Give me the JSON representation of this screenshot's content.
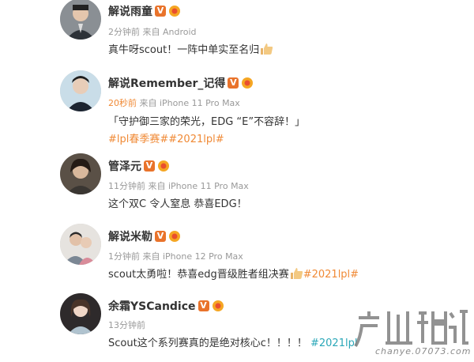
{
  "comments": [
    {
      "username": "解说雨童",
      "time": "2分钟前",
      "source": "来自 Android",
      "text": "真牛呀scout！一阵中单实至名归"
    },
    {
      "username": "解说Remember_记得",
      "time": "20秒前",
      "source": "来自 iPhone 11 Pro Max",
      "text": "「守护御三家的荣光，EDG “E”不容辞！」",
      "tags": "#lpl春季赛##2021lpl#"
    },
    {
      "username": "管泽元",
      "time": "11分钟前",
      "source": "来自 iPhone 11 Pro Max",
      "text": "这个双C 令人窒息 恭喜EDG！"
    },
    {
      "username": "解说米勒",
      "time": "1分钟前",
      "source": "来自 iPhone 12 Pro Max",
      "text": "scout太勇啦！恭喜edg晋级胜者组决赛",
      "tags": "#2021lpl#"
    },
    {
      "username": "余霜YSCandice",
      "time": "13分钟前",
      "source": "",
      "text": "Scout这个系列赛真的是绝对核心c！！！！",
      "tags": "#2021lpl"
    }
  ],
  "badges": {
    "verified_letter": "V"
  },
  "watermark": {
    "logo_text": "产业频道",
    "url": "chanye.07073.com"
  },
  "colors": {
    "accent_orange": "#f08a36",
    "verified_badge": "#e9732b",
    "tag_teal": "#2aa7b8"
  },
  "icons": [
    "thumbs-up-icon",
    "verified-badge-icon",
    "level-badge-icon"
  ]
}
